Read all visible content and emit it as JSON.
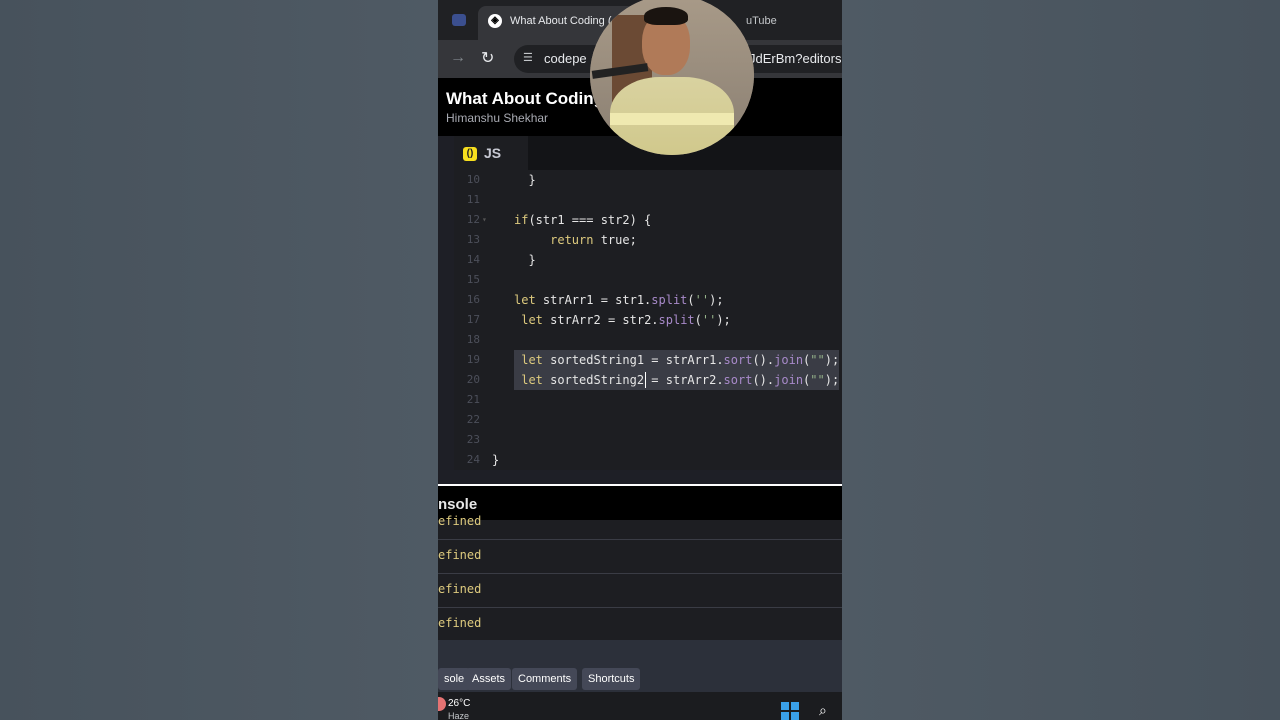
{
  "browser": {
    "active_tab_title": "What About Coding (",
    "other_tab_title": "uTube",
    "url_start": "codepe",
    "url_end": "JdErBm?editors="
  },
  "pen": {
    "title": "What About Coding",
    "author": "Himanshu Shekhar"
  },
  "editor": {
    "tab_label": "JS",
    "tab_icon": "codepen-js-icon",
    "lines": [
      {
        "n": "10",
        "indent": "  ",
        "segments": [
          {
            "t": "}",
            "c": ""
          }
        ]
      },
      {
        "n": "11",
        "indent": "",
        "segments": []
      },
      {
        "n": "12",
        "indent": "",
        "segments": [
          {
            "t": "if",
            "c": "kw"
          },
          {
            "t": "(str1 === str2) {",
            "c": ""
          }
        ]
      },
      {
        "n": "13",
        "indent": "     ",
        "segments": [
          {
            "t": "return",
            "c": "kw"
          },
          {
            "t": " true;",
            "c": ""
          }
        ]
      },
      {
        "n": "14",
        "indent": "  ",
        "segments": [
          {
            "t": "}",
            "c": ""
          }
        ]
      },
      {
        "n": "15",
        "indent": "",
        "segments": []
      },
      {
        "n": "16",
        "indent": "",
        "segments": [
          {
            "t": "let",
            "c": "kw"
          },
          {
            "t": " strArr1 = str1.",
            "c": ""
          },
          {
            "t": "split",
            "c": "fn"
          },
          {
            "t": "(",
            "c": ""
          },
          {
            "t": "''",
            "c": "str"
          },
          {
            "t": ");",
            "c": ""
          }
        ]
      },
      {
        "n": "17",
        "indent": " ",
        "segments": [
          {
            "t": "let",
            "c": "kw"
          },
          {
            "t": " strArr2 = str2.",
            "c": ""
          },
          {
            "t": "split",
            "c": "fn"
          },
          {
            "t": "(",
            "c": ""
          },
          {
            "t": "''",
            "c": "str"
          },
          {
            "t": ");",
            "c": ""
          }
        ]
      },
      {
        "n": "18",
        "indent": "",
        "segments": []
      },
      {
        "n": "19",
        "indent": " ",
        "segments": [
          {
            "t": "let",
            "c": "kw"
          },
          {
            "t": " sortedString1 = strArr1.",
            "c": ""
          },
          {
            "t": "sort",
            "c": "fn"
          },
          {
            "t": "().",
            "c": ""
          },
          {
            "t": "join",
            "c": "fn"
          },
          {
            "t": "(",
            "c": ""
          },
          {
            "t": "\"\"",
            "c": "str"
          },
          {
            "t": ");",
            "c": ""
          }
        ],
        "selected": true
      },
      {
        "n": "20",
        "indent": " ",
        "segments": [
          {
            "t": "let",
            "c": "kw"
          },
          {
            "t": " sortedString2 = strArr2.",
            "c": ""
          },
          {
            "t": "sort",
            "c": "fn"
          },
          {
            "t": "().",
            "c": ""
          },
          {
            "t": "join",
            "c": "fn"
          },
          {
            "t": "(",
            "c": ""
          },
          {
            "t": "\"\"",
            "c": "str"
          },
          {
            "t": ");",
            "c": ""
          }
        ],
        "selected": true,
        "cursor": true
      },
      {
        "n": "21",
        "indent": "",
        "segments": []
      },
      {
        "n": "22",
        "indent": "",
        "segments": []
      },
      {
        "n": "23",
        "indent": "",
        "segments": []
      },
      {
        "n": "24",
        "indent": "",
        "segments": [
          {
            "t": "}",
            "c": ""
          }
        ],
        "outdent": true
      }
    ]
  },
  "console": {
    "title": "nsole",
    "rows": [
      "efined",
      "efined",
      "efined",
      "efined"
    ]
  },
  "bottom_bar": {
    "buttons": [
      "sole",
      "Assets",
      "Comments",
      "Shortcuts"
    ]
  },
  "taskbar": {
    "temperature": "26°C",
    "condition": "Haze"
  },
  "colors": {
    "keyword": "#ddca7e",
    "function": "#a88aca",
    "string": "#96b38a"
  }
}
